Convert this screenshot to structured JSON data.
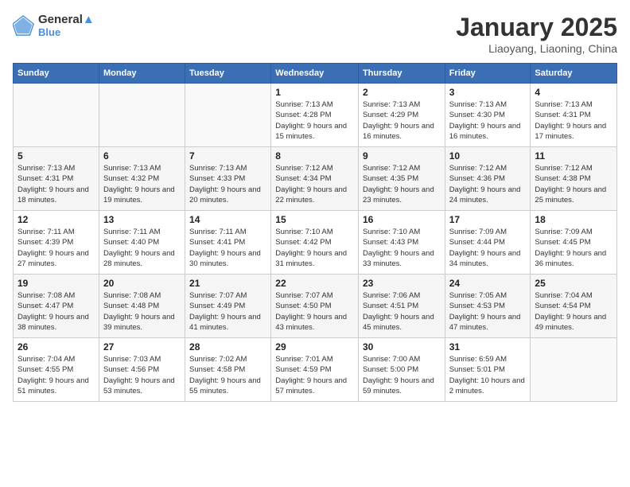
{
  "logo": {
    "line1": "General",
    "line2": "Blue"
  },
  "title": "January 2025",
  "subtitle": "Liaoyang, Liaoning, China",
  "weekdays": [
    "Sunday",
    "Monday",
    "Tuesday",
    "Wednesday",
    "Thursday",
    "Friday",
    "Saturday"
  ],
  "weeks": [
    [
      {
        "day": "",
        "sunrise": "",
        "sunset": "",
        "daylight": ""
      },
      {
        "day": "",
        "sunrise": "",
        "sunset": "",
        "daylight": ""
      },
      {
        "day": "",
        "sunrise": "",
        "sunset": "",
        "daylight": ""
      },
      {
        "day": "1",
        "sunrise": "Sunrise: 7:13 AM",
        "sunset": "Sunset: 4:28 PM",
        "daylight": "Daylight: 9 hours and 15 minutes."
      },
      {
        "day": "2",
        "sunrise": "Sunrise: 7:13 AM",
        "sunset": "Sunset: 4:29 PM",
        "daylight": "Daylight: 9 hours and 16 minutes."
      },
      {
        "day": "3",
        "sunrise": "Sunrise: 7:13 AM",
        "sunset": "Sunset: 4:30 PM",
        "daylight": "Daylight: 9 hours and 16 minutes."
      },
      {
        "day": "4",
        "sunrise": "Sunrise: 7:13 AM",
        "sunset": "Sunset: 4:31 PM",
        "daylight": "Daylight: 9 hours and 17 minutes."
      }
    ],
    [
      {
        "day": "5",
        "sunrise": "Sunrise: 7:13 AM",
        "sunset": "Sunset: 4:31 PM",
        "daylight": "Daylight: 9 hours and 18 minutes."
      },
      {
        "day": "6",
        "sunrise": "Sunrise: 7:13 AM",
        "sunset": "Sunset: 4:32 PM",
        "daylight": "Daylight: 9 hours and 19 minutes."
      },
      {
        "day": "7",
        "sunrise": "Sunrise: 7:13 AM",
        "sunset": "Sunset: 4:33 PM",
        "daylight": "Daylight: 9 hours and 20 minutes."
      },
      {
        "day": "8",
        "sunrise": "Sunrise: 7:12 AM",
        "sunset": "Sunset: 4:34 PM",
        "daylight": "Daylight: 9 hours and 22 minutes."
      },
      {
        "day": "9",
        "sunrise": "Sunrise: 7:12 AM",
        "sunset": "Sunset: 4:35 PM",
        "daylight": "Daylight: 9 hours and 23 minutes."
      },
      {
        "day": "10",
        "sunrise": "Sunrise: 7:12 AM",
        "sunset": "Sunset: 4:36 PM",
        "daylight": "Daylight: 9 hours and 24 minutes."
      },
      {
        "day": "11",
        "sunrise": "Sunrise: 7:12 AM",
        "sunset": "Sunset: 4:38 PM",
        "daylight": "Daylight: 9 hours and 25 minutes."
      }
    ],
    [
      {
        "day": "12",
        "sunrise": "Sunrise: 7:11 AM",
        "sunset": "Sunset: 4:39 PM",
        "daylight": "Daylight: 9 hours and 27 minutes."
      },
      {
        "day": "13",
        "sunrise": "Sunrise: 7:11 AM",
        "sunset": "Sunset: 4:40 PM",
        "daylight": "Daylight: 9 hours and 28 minutes."
      },
      {
        "day": "14",
        "sunrise": "Sunrise: 7:11 AM",
        "sunset": "Sunset: 4:41 PM",
        "daylight": "Daylight: 9 hours and 30 minutes."
      },
      {
        "day": "15",
        "sunrise": "Sunrise: 7:10 AM",
        "sunset": "Sunset: 4:42 PM",
        "daylight": "Daylight: 9 hours and 31 minutes."
      },
      {
        "day": "16",
        "sunrise": "Sunrise: 7:10 AM",
        "sunset": "Sunset: 4:43 PM",
        "daylight": "Daylight: 9 hours and 33 minutes."
      },
      {
        "day": "17",
        "sunrise": "Sunrise: 7:09 AM",
        "sunset": "Sunset: 4:44 PM",
        "daylight": "Daylight: 9 hours and 34 minutes."
      },
      {
        "day": "18",
        "sunrise": "Sunrise: 7:09 AM",
        "sunset": "Sunset: 4:45 PM",
        "daylight": "Daylight: 9 hours and 36 minutes."
      }
    ],
    [
      {
        "day": "19",
        "sunrise": "Sunrise: 7:08 AM",
        "sunset": "Sunset: 4:47 PM",
        "daylight": "Daylight: 9 hours and 38 minutes."
      },
      {
        "day": "20",
        "sunrise": "Sunrise: 7:08 AM",
        "sunset": "Sunset: 4:48 PM",
        "daylight": "Daylight: 9 hours and 39 minutes."
      },
      {
        "day": "21",
        "sunrise": "Sunrise: 7:07 AM",
        "sunset": "Sunset: 4:49 PM",
        "daylight": "Daylight: 9 hours and 41 minutes."
      },
      {
        "day": "22",
        "sunrise": "Sunrise: 7:07 AM",
        "sunset": "Sunset: 4:50 PM",
        "daylight": "Daylight: 9 hours and 43 minutes."
      },
      {
        "day": "23",
        "sunrise": "Sunrise: 7:06 AM",
        "sunset": "Sunset: 4:51 PM",
        "daylight": "Daylight: 9 hours and 45 minutes."
      },
      {
        "day": "24",
        "sunrise": "Sunrise: 7:05 AM",
        "sunset": "Sunset: 4:53 PM",
        "daylight": "Daylight: 9 hours and 47 minutes."
      },
      {
        "day": "25",
        "sunrise": "Sunrise: 7:04 AM",
        "sunset": "Sunset: 4:54 PM",
        "daylight": "Daylight: 9 hours and 49 minutes."
      }
    ],
    [
      {
        "day": "26",
        "sunrise": "Sunrise: 7:04 AM",
        "sunset": "Sunset: 4:55 PM",
        "daylight": "Daylight: 9 hours and 51 minutes."
      },
      {
        "day": "27",
        "sunrise": "Sunrise: 7:03 AM",
        "sunset": "Sunset: 4:56 PM",
        "daylight": "Daylight: 9 hours and 53 minutes."
      },
      {
        "day": "28",
        "sunrise": "Sunrise: 7:02 AM",
        "sunset": "Sunset: 4:58 PM",
        "daylight": "Daylight: 9 hours and 55 minutes."
      },
      {
        "day": "29",
        "sunrise": "Sunrise: 7:01 AM",
        "sunset": "Sunset: 4:59 PM",
        "daylight": "Daylight: 9 hours and 57 minutes."
      },
      {
        "day": "30",
        "sunrise": "Sunrise: 7:00 AM",
        "sunset": "Sunset: 5:00 PM",
        "daylight": "Daylight: 9 hours and 59 minutes."
      },
      {
        "day": "31",
        "sunrise": "Sunrise: 6:59 AM",
        "sunset": "Sunset: 5:01 PM",
        "daylight": "Daylight: 10 hours and 2 minutes."
      },
      {
        "day": "",
        "sunrise": "",
        "sunset": "",
        "daylight": ""
      }
    ]
  ]
}
